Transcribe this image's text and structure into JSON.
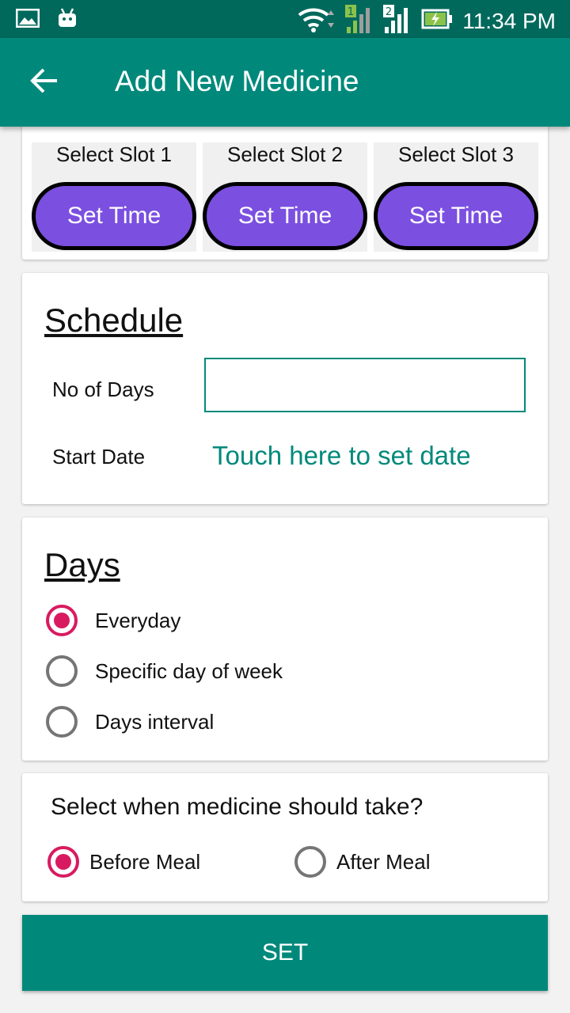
{
  "status_bar": {
    "time": "11:34 PM",
    "sim1": "1",
    "sim2": "2"
  },
  "app_bar": {
    "title": "Add New Medicine",
    "back_icon": "arrow-left-icon"
  },
  "slots": [
    {
      "label": "Select Slot 1",
      "button": "Set Time"
    },
    {
      "label": "Select Slot 2",
      "button": "Set Time"
    },
    {
      "label": "Select Slot 3",
      "button": "Set Time"
    }
  ],
  "schedule": {
    "title": "Schedule",
    "days_label": "No of Days",
    "days_value": "",
    "start_date_label": "Start Date",
    "start_date_link": "Touch here to set date"
  },
  "days": {
    "title": "Days",
    "options": [
      {
        "label": "Everyday",
        "checked": true
      },
      {
        "label": "Specific day of week",
        "checked": false
      },
      {
        "label": "Days interval",
        "checked": false
      }
    ]
  },
  "meal": {
    "question": "Select when medicine should take?",
    "options": [
      {
        "label": "Before Meal",
        "checked": true
      },
      {
        "label": "After Meal",
        "checked": false
      }
    ]
  },
  "set_button": "SET",
  "colors": {
    "primary": "#00897b",
    "primary_dark": "#00695c",
    "accent": "#d81b60",
    "slot_button": "#7b4fe0"
  }
}
